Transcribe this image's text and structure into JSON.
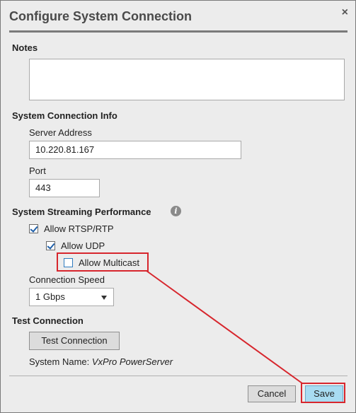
{
  "dialog": {
    "title": "Configure System Connection",
    "close_glyph": "×"
  },
  "notes": {
    "heading": "Notes",
    "value": ""
  },
  "connection_info": {
    "heading": "System Connection Info",
    "server_label": "Server Address",
    "server_value": "10.220.81.167",
    "port_label": "Port",
    "port_value": "443"
  },
  "streaming": {
    "heading": "System Streaming Performance",
    "info_icon": "info-icon",
    "allow_rtsp_label": "Allow RTSP/RTP",
    "allow_rtsp_checked": true,
    "allow_udp_label": "Allow UDP",
    "allow_udp_checked": true,
    "allow_multicast_label": "Allow Multicast",
    "allow_multicast_checked": false,
    "speed_label": "Connection Speed",
    "speed_value": "1 Gbps"
  },
  "test": {
    "heading": "Test Connection",
    "button_label": "Test Connection",
    "system_name_label": "System Name:",
    "system_name_value": "VxPro PowerServer"
  },
  "footer": {
    "cancel_label": "Cancel",
    "save_label": "Save"
  },
  "colors": {
    "annotation": "#d7262d",
    "save_button": "#a8dcf2",
    "checkbox_check": "#1f5fa8"
  }
}
